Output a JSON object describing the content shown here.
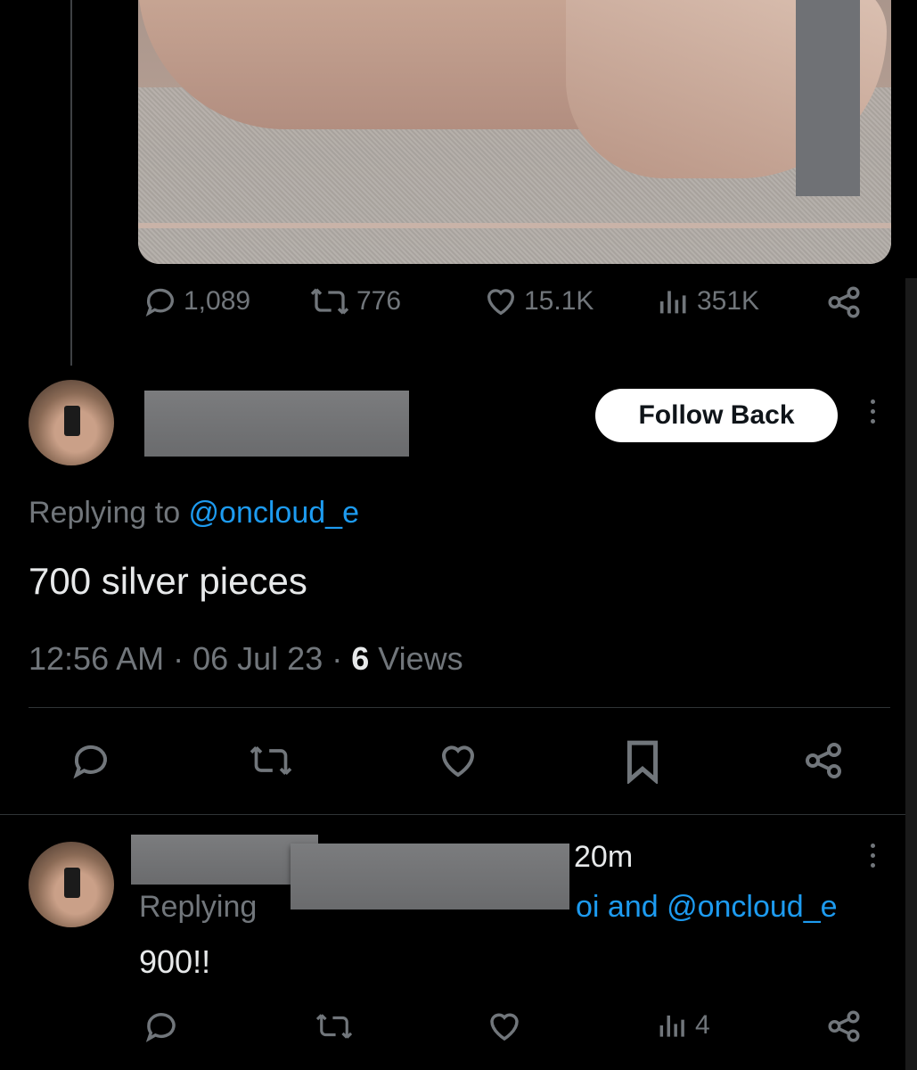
{
  "top_tweet": {
    "stats": {
      "replies": "1,089",
      "reposts": "776",
      "likes": "15.1K",
      "views": "351K"
    }
  },
  "main_reply": {
    "name_partial": "",
    "follow_button": "Follow Back",
    "replying_prefix": "Replying to ",
    "replying_handle": "@oncloud_e",
    "text": "700 silver pieces",
    "time": "12:56 AM",
    "date": "06 Jul 23",
    "separator": " · ",
    "views_count": "6",
    "views_label": "Views"
  },
  "second_reply": {
    "time_ago": "20m",
    "replying_prefix": "Replying",
    "replying_tail": "oi and ",
    "replying_handle": "@oncloud_e",
    "text": "900!!",
    "views": "4"
  },
  "colors": {
    "background": "#000000",
    "text": "#e7e9ea",
    "muted": "#71767b",
    "link": "#1d9bf0",
    "divider": "#2f3336"
  },
  "icons": [
    "reply-icon",
    "repost-icon",
    "like-icon",
    "views-icon",
    "share-icon",
    "bookmark-icon",
    "more-icon"
  ]
}
